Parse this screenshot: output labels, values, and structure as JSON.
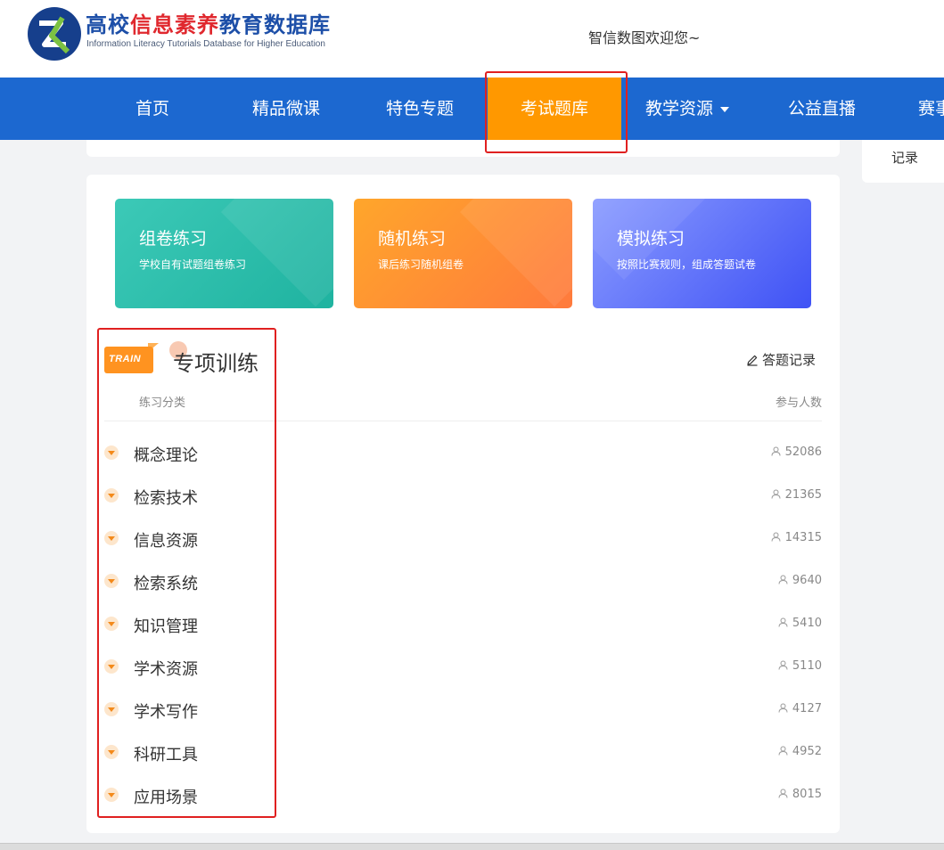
{
  "header": {
    "logo_title_part1": "高校",
    "logo_title_part2": "信息素养",
    "logo_title_part3": "教育数据库",
    "logo_subtitle": "Information Literacy Tutorials Database for Higher Education",
    "welcome": "智信数图欢迎您~"
  },
  "nav": {
    "items": [
      {
        "label": "首页"
      },
      {
        "label": "精品微课"
      },
      {
        "label": "特色专题"
      },
      {
        "label": "考试题库",
        "active": true
      },
      {
        "label": "教学资源",
        "has_dropdown": true
      },
      {
        "label": "公益直播"
      },
      {
        "label": "赛事"
      }
    ]
  },
  "side": {
    "record_label": "记录"
  },
  "tiles": [
    {
      "title": "组卷练习",
      "subtitle": "学校自有试题组卷练习",
      "color": "#1fb3a0"
    },
    {
      "title": "随机练习",
      "subtitle": "课后练习随机组卷",
      "color": "#ff8a33"
    },
    {
      "title": "模拟练习",
      "subtitle": "按照比赛规则，组成答题试卷",
      "color": "#4a5cf6"
    }
  ],
  "section": {
    "badge": "TRAIN",
    "title": "专项训练",
    "answer_record": "答题记录",
    "col_category": "练习分类",
    "col_participants": "参与人数",
    "rows": [
      {
        "label": "概念理论",
        "count": "52086"
      },
      {
        "label": "检索技术",
        "count": "21365"
      },
      {
        "label": "信息资源",
        "count": "14315"
      },
      {
        "label": "检索系统",
        "count": "9640"
      },
      {
        "label": "知识管理",
        "count": "5410"
      },
      {
        "label": "学术资源",
        "count": "5110"
      },
      {
        "label": "学术写作",
        "count": "4127"
      },
      {
        "label": "科研工具",
        "count": "4952"
      },
      {
        "label": "应用场景",
        "count": "8015"
      }
    ]
  },
  "colors": {
    "nav_bg": "#1c68d0",
    "nav_active": "#ff9800",
    "annotation": "#e02020"
  }
}
